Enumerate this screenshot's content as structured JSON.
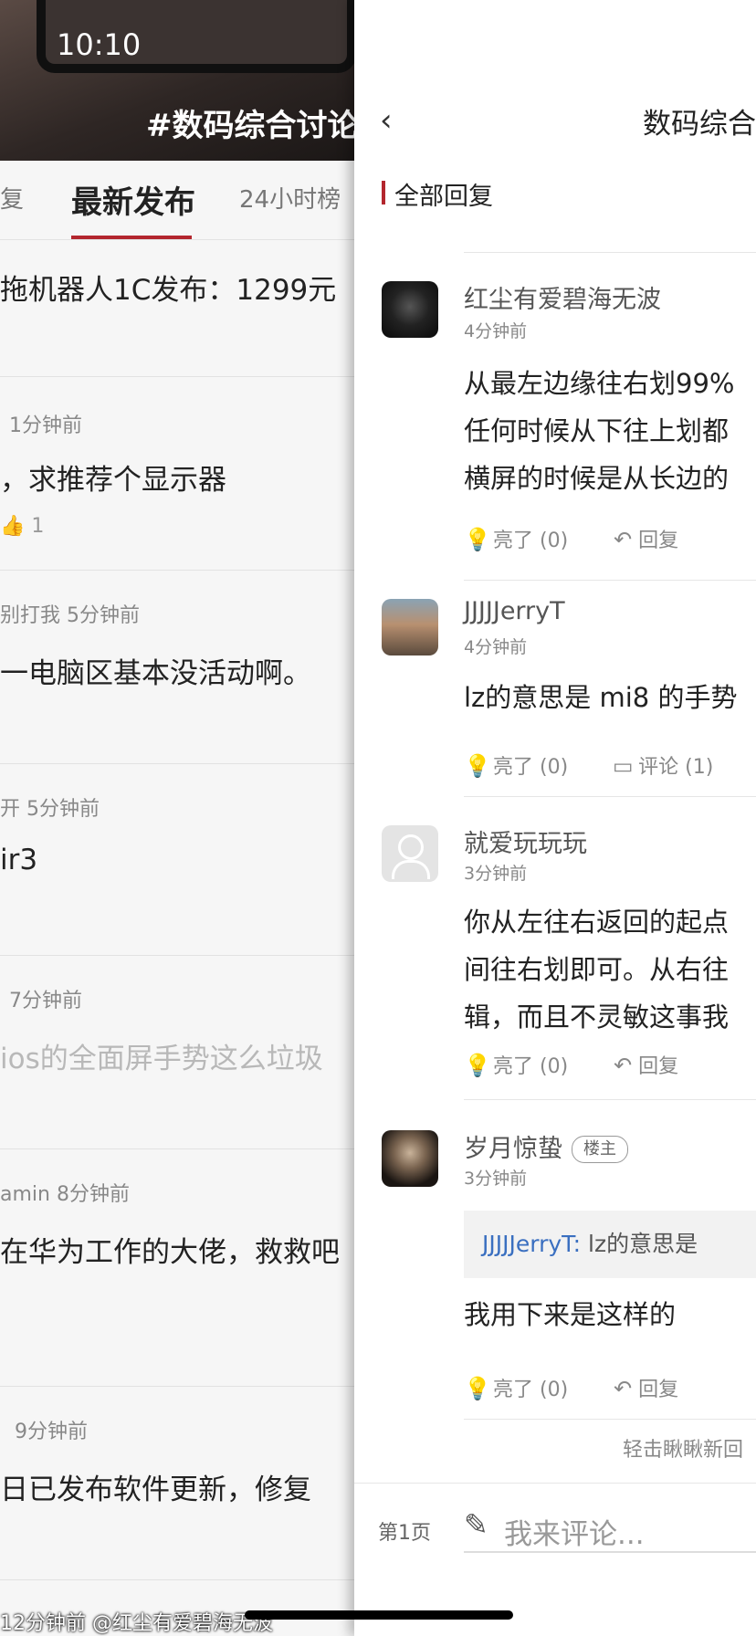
{
  "status_bar": {
    "time": "10:10"
  },
  "left_panel": {
    "topic_title": "#数码综合讨论",
    "tabs": [
      {
        "label": "复",
        "active": false
      },
      {
        "label": "最新发布",
        "active": true
      },
      {
        "label": "24小时榜",
        "active": false
      }
    ],
    "posts": [
      {
        "meta": "",
        "title": "拖机器人1C发布：1299元",
        "likes": ""
      },
      {
        "meta": "1分钟前",
        "title": "，求推荐个显示器",
        "likes": "1"
      },
      {
        "meta": "别打我  5分钟前",
        "title": "一电脑区基本没活动啊。",
        "likes": ""
      },
      {
        "meta": "开  5分钟前",
        "title": "ir3",
        "likes": ""
      },
      {
        "meta": "7分钟前",
        "title": "ios的全面屏手势这么垃圾",
        "likes": ""
      },
      {
        "meta": "amin  8分钟前",
        "title": "在华为工作的大佬，救救吧",
        "likes": ""
      },
      {
        "meta": "9分钟前",
        "title": "日已发布软件更新，修复",
        "likes": ""
      }
    ],
    "watermark": "12分钟前 @红尘有爱碧海无波"
  },
  "drawer": {
    "title": "数码综合",
    "section_label": "全部回复",
    "comments": [
      {
        "username": "红尘有爱碧海无波",
        "time": "4分钟前",
        "lines": [
          "从最左边缘往右划99%",
          "任何时候从下往上划都",
          "横屏的时候是从长边的"
        ],
        "actions": [
          {
            "icon": "bulb-icon",
            "label": "亮了 (0)"
          },
          {
            "icon": "reply-icon",
            "label": "回复"
          }
        ]
      },
      {
        "username": "JJJJJerryT",
        "time": "4分钟前",
        "lines": [
          "lz的意思是 mi8 的手势"
        ],
        "actions": [
          {
            "icon": "bulb-icon",
            "label": "亮了 (0)"
          },
          {
            "icon": "comment-icon",
            "label": "评论 (1)"
          }
        ]
      },
      {
        "username": "就爱玩玩玩",
        "time": "3分钟前",
        "lines": [
          "你从左往右返回的起点",
          "间往右划即可。从右往",
          "辑，而且不灵敏这事我"
        ],
        "actions": [
          {
            "icon": "bulb-icon",
            "label": "亮了 (0)"
          },
          {
            "icon": "reply-icon",
            "label": "回复"
          }
        ]
      },
      {
        "username": "岁月惊蛰",
        "badge": "楼主",
        "time": "3分钟前",
        "quote_name": "JJJJJerryT:",
        "quote_text": " lz的意思是",
        "lines": [
          "我用下来是这样的"
        ],
        "actions": [
          {
            "icon": "bulb-icon",
            "label": "亮了 (0)"
          },
          {
            "icon": "reply-icon",
            "label": "回复"
          }
        ]
      }
    ],
    "tap_more": "轻击瞅瞅新回",
    "page_label": "第1页",
    "comment_placeholder": "我来评论...",
    "icons": {
      "bulb": "💡",
      "reply": "↶",
      "comment": "▭",
      "pen": "✎",
      "back": "‹"
    },
    "colors": {
      "accent": "#b3262e",
      "link": "#3a6fc0"
    }
  }
}
